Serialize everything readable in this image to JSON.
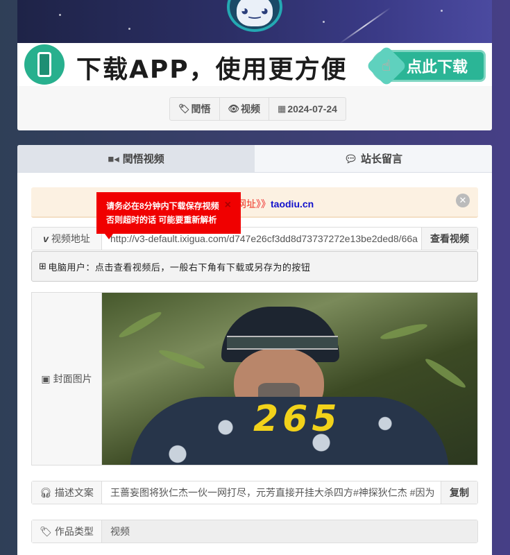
{
  "banner": {
    "text": "下载APP，使用更方便",
    "button_label": "点此下载"
  },
  "tags": [
    {
      "icon": "tag-icon",
      "label": "閏悟"
    },
    {
      "icon": "eye-icon",
      "label": "视频"
    },
    {
      "icon": "calendar-icon",
      "label": "2024-07-24"
    }
  ],
  "tabs": [
    {
      "icon": "video-camera-icon",
      "label": "閏悟视频",
      "active": true
    },
    {
      "icon": "comment-icon",
      "label": "站长留言",
      "active": false
    }
  ],
  "notice": {
    "text_partial": "网址",
    "arrows": "》》",
    "domain": "taodiu.cn"
  },
  "popup": {
    "line1": "请务必在8分钟内下载保存视频",
    "line2": "否则超时的话 可能要重新解析",
    "close": "×"
  },
  "video_url_row": {
    "label": "视频地址",
    "value": "http://v3-default.ixigua.com/d747e26cf3dd8d73737272e13be2ded8/66a",
    "button": "查看视频"
  },
  "hint": {
    "text": "电脑用户：点击查看视频后，一般右下角有下载或另存为的按钮"
  },
  "cover_row": {
    "label": "封面图片",
    "overlay_number": "265"
  },
  "desc_row": {
    "label": "描述文案",
    "value": "王蔷妄图将狄仁杰一伙一网打尽，元芳直接开挂大杀四方#神探狄仁杰 #因为",
    "button": "复制"
  },
  "type_row": {
    "label": "作品类型",
    "value": "视频"
  },
  "colors": {
    "accent_green": "#2bb596",
    "popup_red": "#f00000",
    "domain_blue": "#1111cc"
  }
}
